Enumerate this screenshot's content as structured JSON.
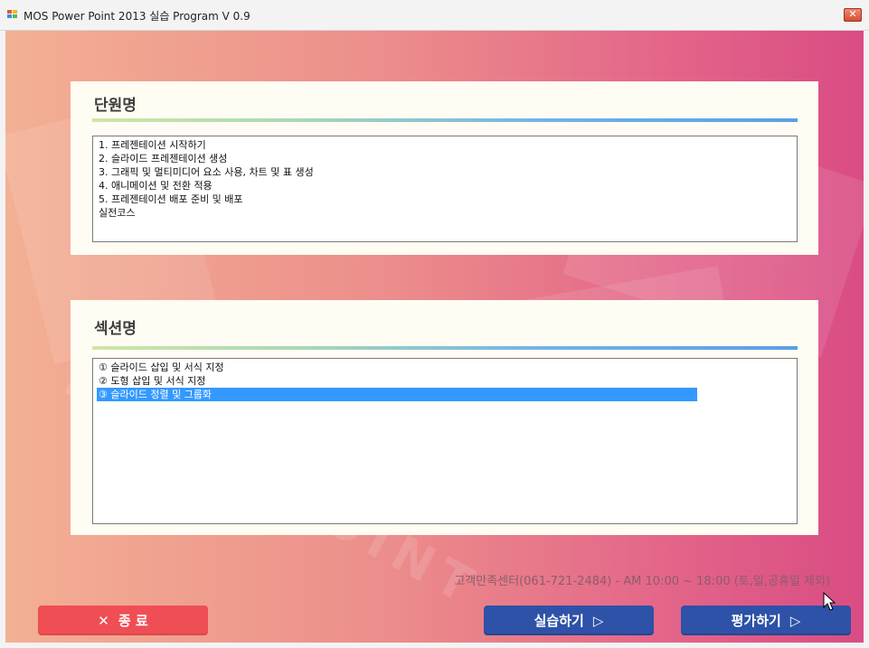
{
  "window": {
    "title": "MOS Power Point 2013 실습 Program V 0.9",
    "close_glyph": "✕"
  },
  "units_panel": {
    "title": "단원명",
    "items": [
      "1. 프레젠테이션 시작하기",
      "2. 슬라이드 프레젠테이션 생성",
      "3. 그래픽 및 멀티미디어 요소 사용, 차트 및 표 생성",
      "4. 애니메이션 및 전환 적용",
      "5. 프레젠테이션 배포 준비 및 배포",
      "실전코스"
    ]
  },
  "sections_panel": {
    "title": "섹션명",
    "items": [
      "① 슬라이드 삽입 및 서식 지정",
      "② 도형 삽입 및 서식 지정",
      "③ 슬라이드 정렬 및 그룹화"
    ],
    "selected_item": "③ 슬라이드 정렬 및 그룹화"
  },
  "watermark": "POWERPOINT",
  "support_text": "고객만족센터(061-721-2484) - AM 10:00 ~ 18:00 (토,일,공휴일 제외)",
  "buttons": {
    "exit_icon": "✕",
    "exit_label": "종 료",
    "practice_label": "실습하기",
    "practice_icon": "▷",
    "evaluate_label": "평가하기",
    "evaluate_icon": "▷"
  },
  "colors": {
    "exit_button": "#ef4e55",
    "action_button": "#2d52a8",
    "selection": "#3399ff"
  },
  "icons": {
    "app": "app-icon",
    "close": "close-icon",
    "cursor": "mouse-pointer-icon"
  }
}
